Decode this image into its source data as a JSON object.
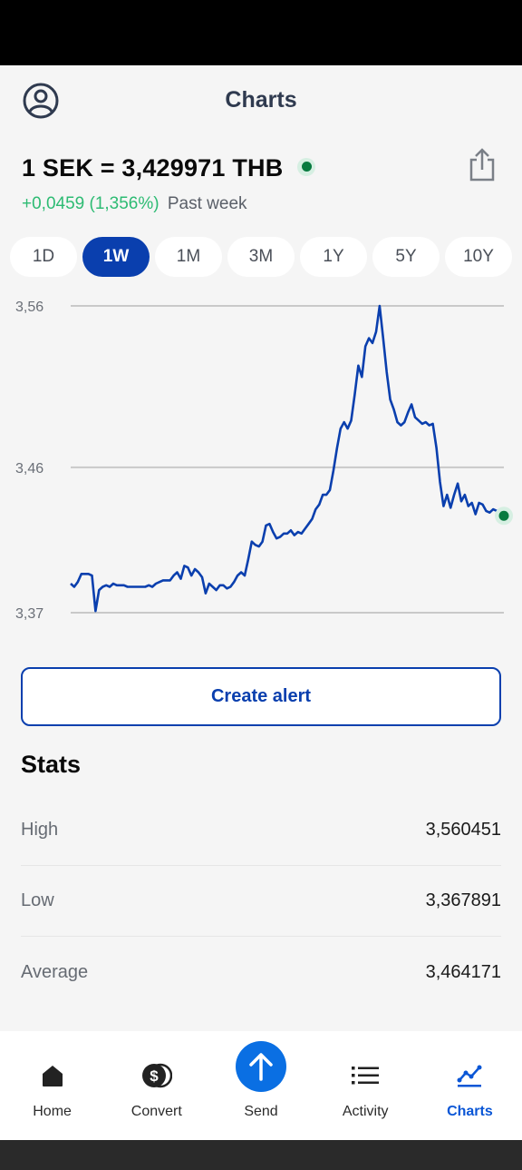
{
  "header": {
    "title": "Charts"
  },
  "rate": {
    "text": "1 SEK = 3,429971 THB",
    "change": "+0,0459 (1,356%)",
    "period": "Past week"
  },
  "ranges": [
    "1D",
    "1W",
    "1M",
    "3M",
    "1Y",
    "5Y",
    "10Y"
  ],
  "selected_range": "1W",
  "chart_data": {
    "type": "line",
    "ytick_labels": [
      "3,56",
      "3,46",
      "3,37"
    ],
    "yticks": [
      3.56,
      3.46,
      3.37
    ],
    "ylim": [
      3.37,
      3.56
    ],
    "grid": true,
    "line_color": "#0a3fae",
    "series": [
      {
        "values": [
          3.388,
          3.386,
          3.389,
          3.394,
          3.394,
          3.394,
          3.393,
          3.371,
          3.384,
          3.386,
          3.387,
          3.386,
          3.388,
          3.387,
          3.387,
          3.387,
          3.386,
          3.386,
          3.386,
          3.386,
          3.386,
          3.386,
          3.387,
          3.386,
          3.388,
          3.389,
          3.39,
          3.39,
          3.39,
          3.393,
          3.395,
          3.391,
          3.399,
          3.398,
          3.393,
          3.397,
          3.395,
          3.392,
          3.382,
          3.388,
          3.386,
          3.384,
          3.387,
          3.387,
          3.385,
          3.386,
          3.389,
          3.393,
          3.395,
          3.393,
          3.403,
          3.414,
          3.412,
          3.411,
          3.414,
          3.424,
          3.425,
          3.42,
          3.416,
          3.417,
          3.419,
          3.419,
          3.421,
          3.418,
          3.42,
          3.419,
          3.422,
          3.425,
          3.428,
          3.434,
          3.437,
          3.443,
          3.443,
          3.446,
          3.458,
          3.472,
          3.484,
          3.488,
          3.484,
          3.489,
          3.505,
          3.523,
          3.516,
          3.535,
          3.54,
          3.537,
          3.544,
          3.56,
          3.54,
          3.519,
          3.502,
          3.496,
          3.488,
          3.486,
          3.488,
          3.494,
          3.499,
          3.491,
          3.489,
          3.487,
          3.488,
          3.486,
          3.487,
          3.472,
          3.451,
          3.436,
          3.443,
          3.435,
          3.443,
          3.45,
          3.439,
          3.443,
          3.436,
          3.438,
          3.431,
          3.438,
          3.437,
          3.433,
          3.432,
          3.434,
          3.433,
          3.431,
          3.43
        ]
      }
    ]
  },
  "actions": {
    "create_alert": "Create alert"
  },
  "stats": {
    "title": "Stats",
    "rows": [
      {
        "label": "High",
        "value": "3,560451"
      },
      {
        "label": "Low",
        "value": "3,367891"
      },
      {
        "label": "Average",
        "value": "3,464171"
      }
    ]
  },
  "nav": {
    "items": [
      {
        "label": "Home",
        "icon": "home-icon"
      },
      {
        "label": "Convert",
        "icon": "convert-icon"
      },
      {
        "label": "Send",
        "icon": "send-icon"
      },
      {
        "label": "Activity",
        "icon": "activity-icon"
      },
      {
        "label": "Charts",
        "icon": "charts-icon"
      }
    ],
    "active": "Charts"
  },
  "colors": {
    "accent": "#0a3fae",
    "positive": "#2dbb73",
    "live": "#087a3f",
    "send": "#0a6fe3"
  }
}
